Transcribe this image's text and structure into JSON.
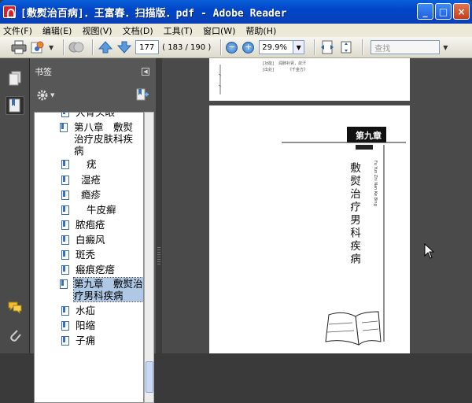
{
  "window": {
    "title": "[敷熨治百病]．王富春．扫描版．pdf - Adobe Reader",
    "minimize": "_",
    "maximize": "□",
    "close": "×"
  },
  "menu": [
    "文件(F)",
    "编辑(E)",
    "视图(V)",
    "文档(D)",
    "工具(T)",
    "窗口(W)",
    "帮助(H)"
  ],
  "toolbar": {
    "page_current": "177",
    "page_total": "( 183 / 190 )",
    "zoom_value": "29.9%",
    "search_placeholder": "查找"
  },
  "panel": {
    "title": "书签"
  },
  "bookmarks": [
    {
      "label": "大骨头眼",
      "level": 1,
      "selected": false
    },
    {
      "label": "第八章　敷熨治疗皮肤科疾病",
      "level": 0,
      "selected": false
    },
    {
      "label": "疣",
      "level": 1,
      "selected": false
    },
    {
      "label": "湿疮",
      "level": 1,
      "selected": false
    },
    {
      "label": "瘾疹",
      "level": 1,
      "selected": false
    },
    {
      "label": "牛皮癣",
      "level": 1,
      "selected": false
    },
    {
      "label": "脓疱疮",
      "level": 1,
      "selected": false
    },
    {
      "label": "白癜风",
      "level": 1,
      "selected": false
    },
    {
      "label": "斑秃",
      "level": 1,
      "selected": false
    },
    {
      "label": "瘢痕疙瘩",
      "level": 1,
      "selected": false
    },
    {
      "label": "第九章　敷熨治疗男科疾病",
      "level": 0,
      "selected": true
    },
    {
      "label": "水疝",
      "level": 1,
      "selected": false
    },
    {
      "label": "阳缩",
      "level": 1,
      "selected": false
    },
    {
      "label": "子痈",
      "level": 1,
      "selected": false
    }
  ],
  "page_prev": {
    "line1_label": "[功能]",
    "line1_text": "润肺补肾，敛汗",
    "line2_label": "[出处]",
    "line2_text": "《千金方》"
  },
  "page_current_content": {
    "chapter": "第九章",
    "title": "敷熨治疗男科疾病",
    "pinyin": "Fu Yun Zhi Nan Ke Bing"
  },
  "colors": {
    "title_bar": "#0046c8",
    "selection": "#aec8e6",
    "panel_bg": "#575757",
    "doc_bg": "#4a4a4a"
  }
}
